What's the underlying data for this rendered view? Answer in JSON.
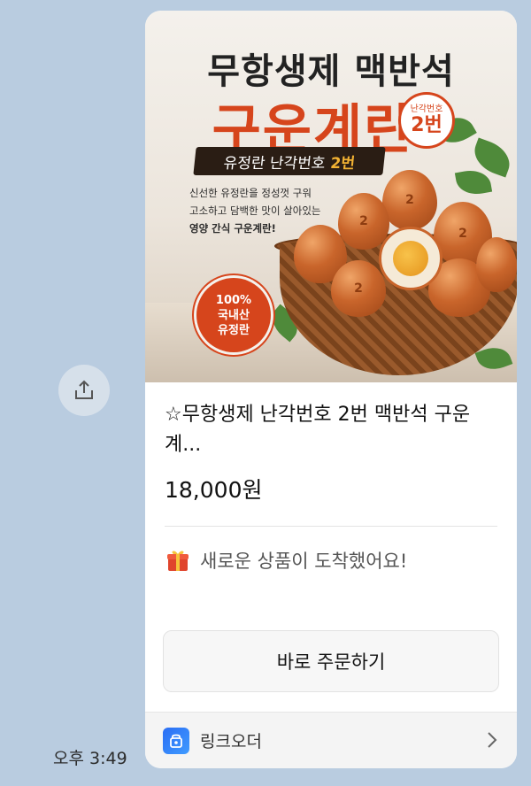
{
  "message": {
    "timestamp": "오후 3:49",
    "share_icon": "share-icon"
  },
  "banner": {
    "title_line1": "무항생제 맥반석",
    "title_line2": "구운계란",
    "pill_text": "유정란 난각번호",
    "pill_highlight": "2번",
    "description_lines": [
      "신선한 유정란을 정성껏 구워",
      "고소하고 담백한 맛이 살아있는",
      "영양 간식 구운계란!"
    ],
    "stamp_small": "난각번호",
    "stamp_big": "2번",
    "badge_lines": [
      "100%",
      "국내산",
      "유정란"
    ],
    "egg_mark": "2"
  },
  "product": {
    "title": "☆무항생제 난각번호 2번 맥반석 구운계...",
    "price": "18,000원"
  },
  "notice": {
    "icon": "gift-icon",
    "text": "새로운 상품이 도착했어요!"
  },
  "cta": {
    "order_label": "바로 주문하기"
  },
  "footer": {
    "brand": "링크오더",
    "icon": "link-order-logo-icon",
    "chevron": "chevron-right-icon"
  },
  "colors": {
    "accent": "#d6451c",
    "chat_bg": "#b9cce0",
    "brand_blue": "#2a6df4"
  }
}
